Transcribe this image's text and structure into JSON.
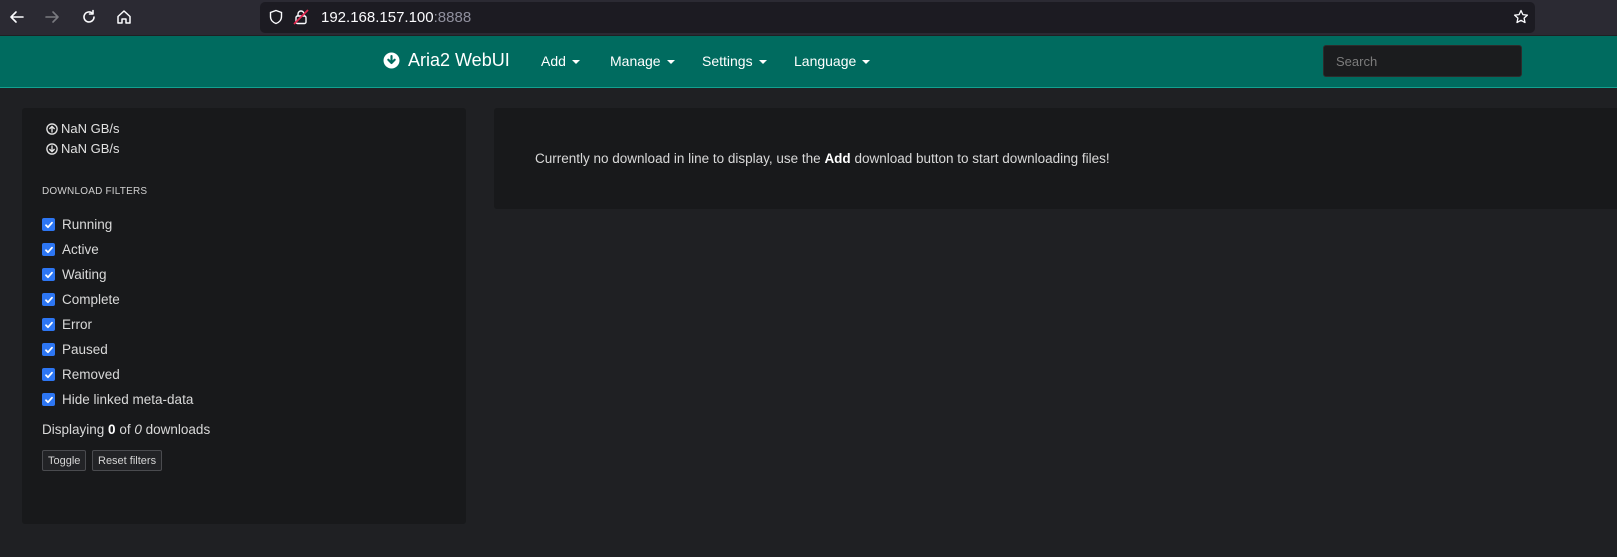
{
  "browser": {
    "url_host": "192.168.157.100",
    "url_port": ":8888"
  },
  "navbar": {
    "brand": "Aria2 WebUI",
    "menus": [
      {
        "label": "Add"
      },
      {
        "label": "Manage"
      },
      {
        "label": "Settings"
      },
      {
        "label": "Language"
      }
    ],
    "search_placeholder": "Search"
  },
  "sidebar": {
    "upload_speed": "NaN GB/s",
    "download_speed": "NaN GB/s",
    "filters_title": "DOWNLOAD FILTERS",
    "filters": [
      {
        "label": "Running",
        "checked": true
      },
      {
        "label": "Active",
        "checked": true
      },
      {
        "label": "Waiting",
        "checked": true
      },
      {
        "label": "Complete",
        "checked": true
      },
      {
        "label": "Error",
        "checked": true
      },
      {
        "label": "Paused",
        "checked": true
      },
      {
        "label": "Removed",
        "checked": true
      },
      {
        "label": "Hide linked meta-data",
        "checked": true
      }
    ],
    "displaying_prefix": "Displaying",
    "displaying_count": "0",
    "displaying_of": "of",
    "displaying_total": "0",
    "displaying_suffix": "downloads",
    "toggle_label": "Toggle",
    "reset_label": "Reset filters"
  },
  "main": {
    "msg_prefix": "Currently no download in line to display, use the",
    "msg_bold": "Add",
    "msg_suffix": "download button to start downloading files!"
  },
  "colors": {
    "navbar": "#006b5f",
    "checkbox": "#2d76f3",
    "background": "#1f2023",
    "panel": "#18191b"
  }
}
